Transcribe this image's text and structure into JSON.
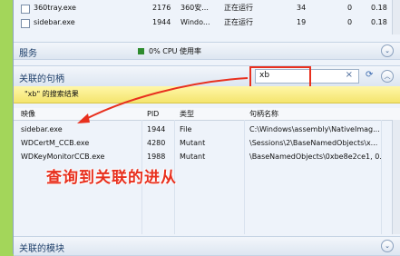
{
  "process_table": {
    "rows": [
      {
        "name": "360tray.exe",
        "pid": "2176",
        "desc": "360安...",
        "status": "正在运行",
        "threads": "34",
        "col6": "0",
        "col7": "0.18"
      },
      {
        "name": "sidebar.exe",
        "pid": "1944",
        "desc": "Windo...",
        "status": "正在运行",
        "threads": "19",
        "col6": "0",
        "col7": "0.18"
      }
    ]
  },
  "services": {
    "title": "服务",
    "cpu_text": "0% CPU 使用率"
  },
  "handles": {
    "title": "关联的句柄",
    "search_value": "xb",
    "result_banner": "\"xb\" 的搜索结果",
    "columns": [
      "映像",
      "PID",
      "类型",
      "句柄名称"
    ],
    "rows": [
      {
        "image": "sidebar.exe",
        "pid": "1944",
        "type": "File",
        "name": "C:\\Windows\\assembly\\NativeImag..."
      },
      {
        "image": "WDCertM_CCB.exe",
        "pid": "4280",
        "type": "Mutant",
        "name": "\\Sessions\\2\\BaseNamedObjects\\x..."
      },
      {
        "image": "WDKeyMonitorCCB.exe",
        "pid": "1988",
        "type": "Mutant",
        "name": "\\BaseNamedObjects\\0xbe8e2ce1, 0..."
      }
    ]
  },
  "annotation": "查询到关联的进从",
  "modules": {
    "title": "关联的模块"
  },
  "colors": {
    "accent_red": "#e8301e",
    "cpu_green": "#2e8b2e"
  }
}
